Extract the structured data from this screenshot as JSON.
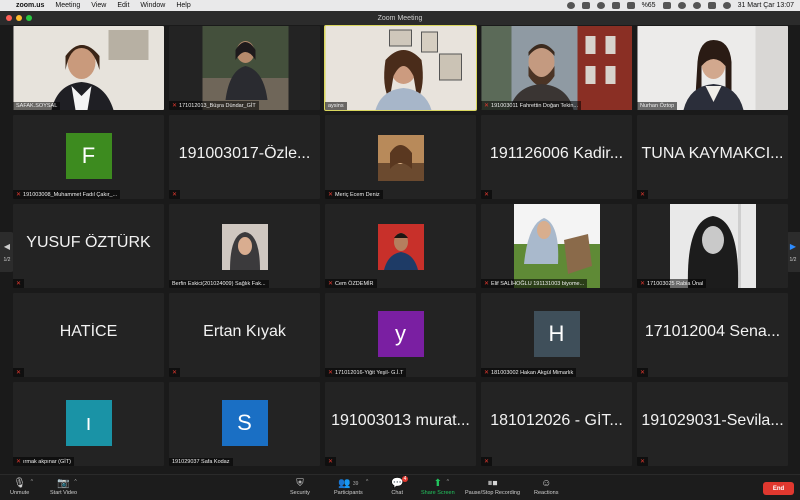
{
  "menubar": {
    "app": "zoom.us",
    "items": [
      "Meeting",
      "View",
      "Edit",
      "Window",
      "Help"
    ],
    "battery": "%65",
    "clock": "31 Mart Çar 13:07"
  },
  "window": {
    "title": "Zoom Meeting"
  },
  "participants": [
    {
      "name": "SAFAK.SOYSAL",
      "display": "",
      "muted": false
    },
    {
      "name": "171012013_Büşra Dündar_GİT",
      "display": "",
      "muted": true
    },
    {
      "name": "aysins",
      "display": "",
      "muted": false
    },
    {
      "name": "191003011 Fahrettin Doğan Tekin...",
      "display": "",
      "muted": true
    },
    {
      "name": "Nurhan Öztop",
      "display": "",
      "muted": false
    },
    {
      "name": "191003008_Muhammet Fadıl Çakır_...",
      "display": "F",
      "muted": true
    },
    {
      "name": "",
      "display": "191003017-Özle...",
      "muted": true
    },
    {
      "name": "Meriç Ecem Deniz",
      "display": "",
      "muted": true
    },
    {
      "name": "",
      "display": "191126006 Kadir...",
      "muted": true
    },
    {
      "name": "",
      "display": "TUNA KAYMAKCI...",
      "muted": true
    },
    {
      "name": "",
      "display": "YUSUF ÖZTÜRK",
      "muted": true
    },
    {
      "name": "Berfin Eskici(201024009) Sağlık Fak...",
      "display": "",
      "muted": false
    },
    {
      "name": "Cem ÖZDEMİR",
      "display": "",
      "muted": true
    },
    {
      "name": "Elif SALİHOĞLU 191131003 biyome...",
      "display": "",
      "muted": true
    },
    {
      "name": "171003025 Rabia Ünal",
      "display": "",
      "muted": true
    },
    {
      "name": "",
      "display": "HATİCE",
      "muted": true
    },
    {
      "name": "",
      "display": "Ertan Kıyak",
      "muted": true
    },
    {
      "name": "171012016-Yiğit Yeşil- G.İ.T",
      "display": "y",
      "muted": true
    },
    {
      "name": "181003002 Hakan Akgül Mimarlık",
      "display": "H",
      "muted": true
    },
    {
      "name": "",
      "display": "171012004 Sena...",
      "muted": true
    },
    {
      "name": "ırmak akpınar (GİT)",
      "display": "ı",
      "muted": true
    },
    {
      "name": "191029037 Safa Kodaz",
      "display": "S",
      "muted": false
    },
    {
      "name": "",
      "display": "191003013 murat...",
      "muted": true
    },
    {
      "name": "",
      "display": "181012026 - GİT...",
      "muted": true
    },
    {
      "name": "",
      "display": "191029031-Sevila...",
      "muted": true
    }
  ],
  "avatar_colors": {
    "F": "#3d8b1f",
    "y": "#7a1fa2",
    "H": "#3f4f5a",
    "ı": "#1a93a6",
    "S": "#1a6fc4"
  },
  "pagination": {
    "left": "1/2",
    "right": "1/2"
  },
  "toolbar": {
    "unmute": "Unmute",
    "start_video": "Start Video",
    "security": "Security",
    "participants": "Participants",
    "participants_count": "39",
    "chat": "Chat",
    "chat_badge": "4",
    "share": "Share Screen",
    "record": "Pause/Stop Recording",
    "reactions": "Reactions",
    "end": "End"
  },
  "colors": {
    "active_speaker": "#d9d65e",
    "end_button": "#e0382f",
    "share_green": "#22c55e",
    "muted_red": "#e0382f"
  }
}
